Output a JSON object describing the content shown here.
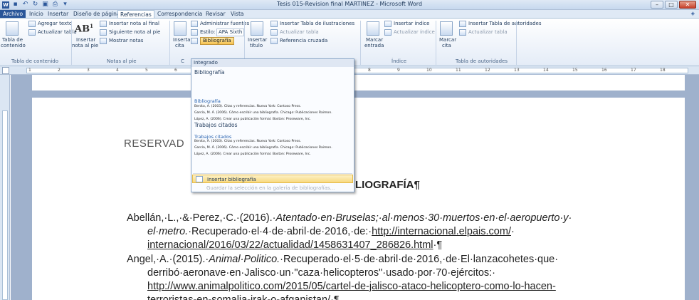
{
  "window": {
    "title": "Tesis 015-Revision final MARTINEZ - Microsoft Word"
  },
  "tabs": {
    "archivo": "Archivo",
    "inicio": "Inicio",
    "insertar": "Insertar",
    "diseno": "Diseño de página",
    "referencias": "Referencias",
    "correspondencia": "Correspondencia",
    "revisar": "Revisar",
    "vista": "Vista"
  },
  "ribbon": {
    "toc": {
      "tabla_contenido": "Tabla de",
      "tabla_contenido2": "contenido",
      "agregar_texto": "Agregar texto",
      "actualizar_tabla": "Actualizar tabla",
      "group_label": "Tabla de contenido"
    },
    "footnotes": {
      "insertar_nota_pie": "Insertar",
      "insertar_nota_pie2": "nota al pie",
      "insertar_nota_final": "Insertar nota al final",
      "siguiente_nota": "Siguiente nota al pie",
      "mostrar_notas": "Mostrar notas",
      "group_label": "Notas al pie"
    },
    "citations": {
      "insertar_cita": "Insertar",
      "insertar_cita2": "cita",
      "administrar_fuentes": "Administrar fuentes",
      "estilo_label": "Estilo:",
      "estilo_value": "APA Sixth",
      "bibliografia": "Bibliografía",
      "group_label": "C"
    },
    "captions": {
      "insertar_titulo": "Insertar",
      "insertar_titulo2": "título",
      "insertar_tabla_ilustraciones": "Insertar Tabla de ilustraciones",
      "actualizar_tabla": "Actualizar tabla",
      "referencia_cruzada": "Referencia cruzada"
    },
    "index": {
      "marcar_entrada": "Marcar",
      "marcar_entrada2": "entrada",
      "insertar_indice": "Insertar índice",
      "actualizar_indice": "Actualizar índice",
      "group_label": "Índice"
    },
    "authorities": {
      "marcar_cita": "Marcar",
      "marcar_cita2": "cita",
      "insertar_tabla_autoridades": "Insertar Tabla de autoridades",
      "actualizar_tabla": "Actualizar tabla",
      "group_label": "Tabla de autoridades"
    }
  },
  "dropdown": {
    "header": "Integrado",
    "section1_title": "Bibliografía",
    "section1_preview_title": "Bibliografía",
    "section2_title": "Trabajos citados",
    "section2_preview_title": "Trabajos citados",
    "preview_lines": [
      "Benito, A. (2003). Citas y referencias. Nueva York: Contoso Press.",
      "García, M. Á. (2006). Cómo escribir una bibliografía. Chicago: Publicaciones Raimon.",
      "López, A. (2006). Crear una publicación formal. Boston: Proseware, Inc."
    ],
    "insertar_bibliografia": "Insertar bibliografía",
    "guardar_seleccion": "Guardar la selección en la galería de bibliografías..."
  },
  "document": {
    "reservado": "RESERVAD",
    "heading": "LIOGRAFÍA¶",
    "ref1": {
      "line1_a": "Abellán,·L.,·&·Perez,·C.·(2016).·",
      "line1_b": "Atentado·en·Bruselas;·al·menos·30·muertos·en·el·aeropuerto·y·",
      "line2_a": "el·metro.",
      "line2_b": "·Recuperado·el·4·de·abril·de·2016,·de:·",
      "line2_link": "http://internacional.elpais.com/",
      "line2_c": "·",
      "line3_link": "internacional/2016/03/22/actualidad/1458631407_286826.html",
      "line3_end": "·¶"
    },
    "ref2": {
      "line1_a": "Angel,·A.·(2015).·",
      "line1_b": "Animal·Politico.",
      "line1_c": "·Recuperado·el·5·de·abril·de·2016,·de·El·lanzacohetes·que·",
      "line2": "derribó·aeronave·en·Jalisco·un·\"caza·helicopteros\"·usado·por·70·ejércitos:·",
      "line3_link": "http://www.animalpolitico.com/2015/05/cartel-de-jalisco-ataco-helicoptero-como-lo-hacen-",
      "line4": "terroristas-en-somalia-irak-o-afganistan/·¶"
    }
  },
  "ruler_numbers": [
    "1",
    "2",
    "3",
    "4",
    "5",
    "6",
    "7",
    "8",
    "9",
    "10",
    "11",
    "12",
    "13",
    "14",
    "15",
    "16",
    "17",
    "18"
  ],
  "colors": {
    "accent": "#2b579a",
    "ribbon_bg": "#dfe9f5",
    "doc_bg": "#9fb1cc",
    "highlight": "#f8d97f"
  }
}
